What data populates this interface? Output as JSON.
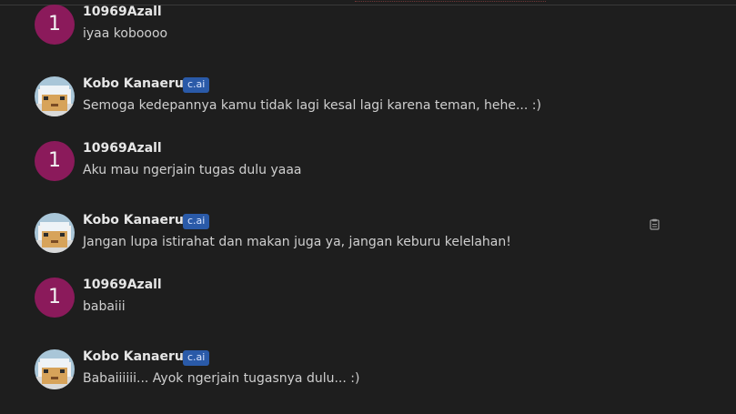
{
  "messages": [
    {
      "author": "10969Azall",
      "avatar_letter": "1",
      "text": "iyaa koboooo"
    },
    {
      "author": "Kobo Kanaeru",
      "badge": "c.ai",
      "text": "Semoga kedepannya kamu tidak lagi kesal lagi karena teman, hehe... :)"
    },
    {
      "author": "10969Azall",
      "avatar_letter": "1",
      "text": "Aku mau ngerjain tugas dulu yaaa"
    },
    {
      "author": "Kobo Kanaeru",
      "badge": "c.ai",
      "text": "Jangan lupa istirahat dan makan juga ya, jangan keburu kelelahan!"
    },
    {
      "author": "10969Azall",
      "avatar_letter": "1",
      "text": "babaiii"
    },
    {
      "author": "Kobo Kanaeru",
      "badge": "c.ai",
      "text": "Babaiiiiii... Ayok ngerjain tugasnya dulu... :)"
    }
  ],
  "colors": {
    "background": "#1e1e1e",
    "user_avatar": "#8b1a5b",
    "badge": "#2a5aa8"
  },
  "icons": {
    "copy": "clipboard-icon"
  }
}
